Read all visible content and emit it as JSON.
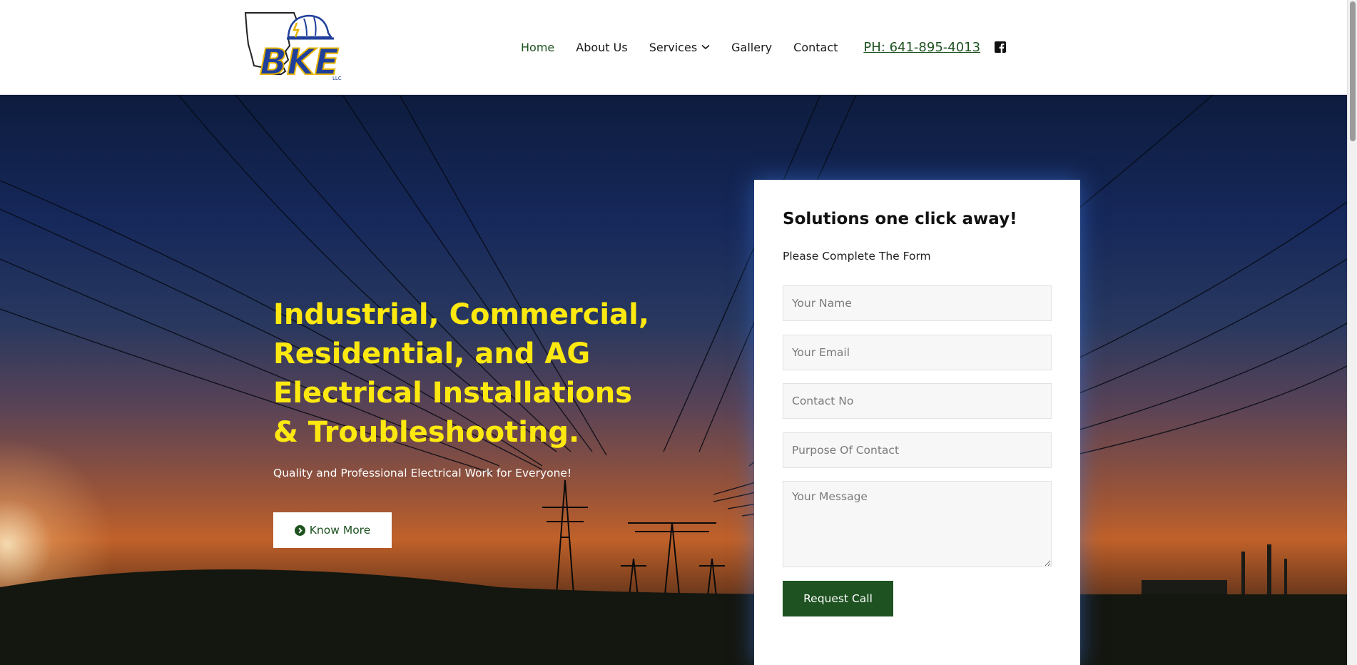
{
  "brand": {
    "logo_text": "BKE",
    "logo_subtext": "LLC"
  },
  "nav": {
    "items": [
      {
        "label": "Home",
        "active": true
      },
      {
        "label": "About Us"
      },
      {
        "label": "Services",
        "has_dropdown": true
      },
      {
        "label": "Gallery"
      },
      {
        "label": "Contact"
      }
    ],
    "phone": "PH: 641-895-4013",
    "social_icon": "facebook-icon"
  },
  "hero": {
    "headline_lines": [
      "Industrial, Commercial,",
      "Residential, and AG",
      "Electrical Installations",
      "& Troubleshooting."
    ],
    "tagline": "Quality and Professional Electrical Work for Everyone!",
    "cta_label": "Know More",
    "cta_icon": "chevron-circle-right-icon"
  },
  "form": {
    "title": "Solutions one click away!",
    "subtitle": "Please Complete The Form",
    "fields": {
      "name": {
        "placeholder": "Your Name"
      },
      "email": {
        "placeholder": "Your Email"
      },
      "contact": {
        "placeholder": "Contact No"
      },
      "purpose": {
        "placeholder": "Purpose Of Contact"
      },
      "message": {
        "placeholder": "Your Message"
      }
    },
    "submit_label": "Request Call"
  },
  "colors": {
    "accent_green": "#1e5220",
    "headline_yellow": "#fde910",
    "logo_blue": "#1f3f9b",
    "logo_gold": "#e8b400"
  }
}
